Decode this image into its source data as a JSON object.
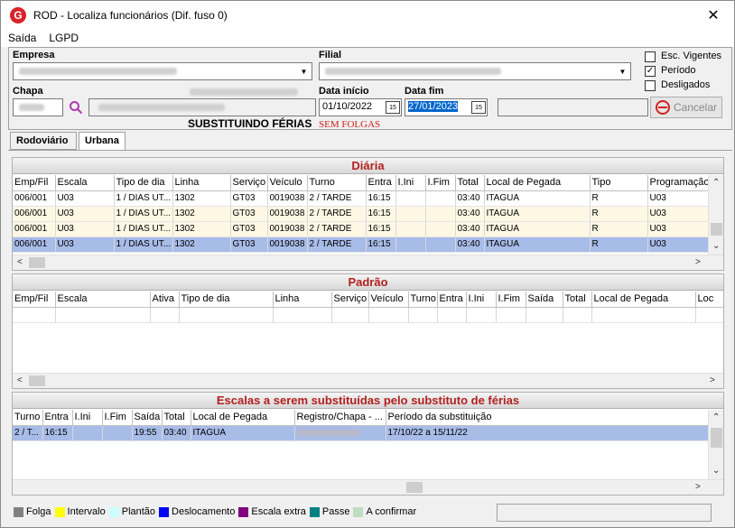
{
  "window": {
    "title": "ROD - Localiza funcionários (Dif. fuso 0)",
    "app_icon": "G"
  },
  "menu": [
    "Saída",
    "LGPD"
  ],
  "form": {
    "empresa_label": "Empresa",
    "filial_label": "Filial",
    "chapa_label": "Chapa",
    "data_inicio_label": "Data início",
    "data_inicio_value": "01/10/2022",
    "data_fim_label": "Data fim",
    "data_fim_value": "27/01/2023",
    "substituindo": "SUBSTITUINDO FÉRIAS",
    "sem_folgas": "SEM FOLGAS",
    "esc_vigentes": "Esc. Vigentes",
    "periodo": "Período",
    "desligados": "Desligados",
    "periodo_checked": true,
    "cancel_label": "Cancelar",
    "calendar_glyph": "15"
  },
  "tabs": [
    "Rodoviário",
    "Urbana"
  ],
  "diaria": {
    "title": "Diária",
    "columns": [
      "Emp/Fil",
      "Escala",
      "Tipo de dia",
      "Linha",
      "Serviço",
      "Veículo",
      "Turno",
      "Entra",
      "I.Ini",
      "I.Fim",
      "Total",
      "Local de Pegada",
      "Tipo",
      "Programação"
    ],
    "rows": [
      [
        "006/001",
        "U03",
        "1 / DIAS UT...",
        "1302",
        "GT03",
        "0019038",
        "2 / TARDE",
        "16:15",
        "",
        "",
        "03:40",
        "ITAGUA",
        "R",
        "U03"
      ],
      [
        "006/001",
        "U03",
        "1 / DIAS UT...",
        "1302",
        "GT03",
        "0019038",
        "2 / TARDE",
        "16:15",
        "",
        "",
        "03:40",
        "ITAGUA",
        "R",
        "U03"
      ],
      [
        "006/001",
        "U03",
        "1 / DIAS UT...",
        "1302",
        "GT03",
        "0019038",
        "2 / TARDE",
        "16:15",
        "",
        "",
        "03:40",
        "ITAGUA",
        "R",
        "U03"
      ],
      [
        "006/001",
        "U03",
        "1 / DIAS UT...",
        "1302",
        "GT03",
        "0019038",
        "2 / TARDE",
        "16:15",
        "",
        "",
        "03:40",
        "ITAGUA",
        "R",
        "U03"
      ]
    ]
  },
  "padrao": {
    "title": "Padrão",
    "columns": [
      "Emp/Fil",
      "Escala",
      "Ativa",
      "Tipo de dia",
      "Linha",
      "Serviço",
      "Veículo",
      "Turno",
      "Entra",
      "I.Ini",
      "I.Fim",
      "Saída",
      "Total",
      "Local de Pegada",
      "Loc"
    ]
  },
  "escalas": {
    "title": "Escalas a serem substituídas pelo substituto de férias",
    "columns": [
      "Turno",
      "Entra",
      "I.Ini",
      "I.Fim",
      "Saída",
      "Total",
      "Local de Pegada",
      "Registro/Chapa - ...",
      "Período da substituição"
    ],
    "rows": [
      [
        "2 / T...",
        "16:15",
        "",
        "",
        "19:55",
        "03:40",
        "ITAGUA",
        "",
        "17/10/22 a 15/11/22"
      ]
    ]
  },
  "legend": [
    {
      "label": "Folga",
      "color": "#808080"
    },
    {
      "label": "Intervalo",
      "color": "#ffff00"
    },
    {
      "label": "Plantão",
      "color": "#ccffff"
    },
    {
      "label": "Deslocamento",
      "color": "#0000ff"
    },
    {
      "label": "Escala extra",
      "color": "#800080"
    },
    {
      "label": "Passe",
      "color": "#008080"
    },
    {
      "label": "A confirmar",
      "color": "#c0dcc0"
    }
  ]
}
